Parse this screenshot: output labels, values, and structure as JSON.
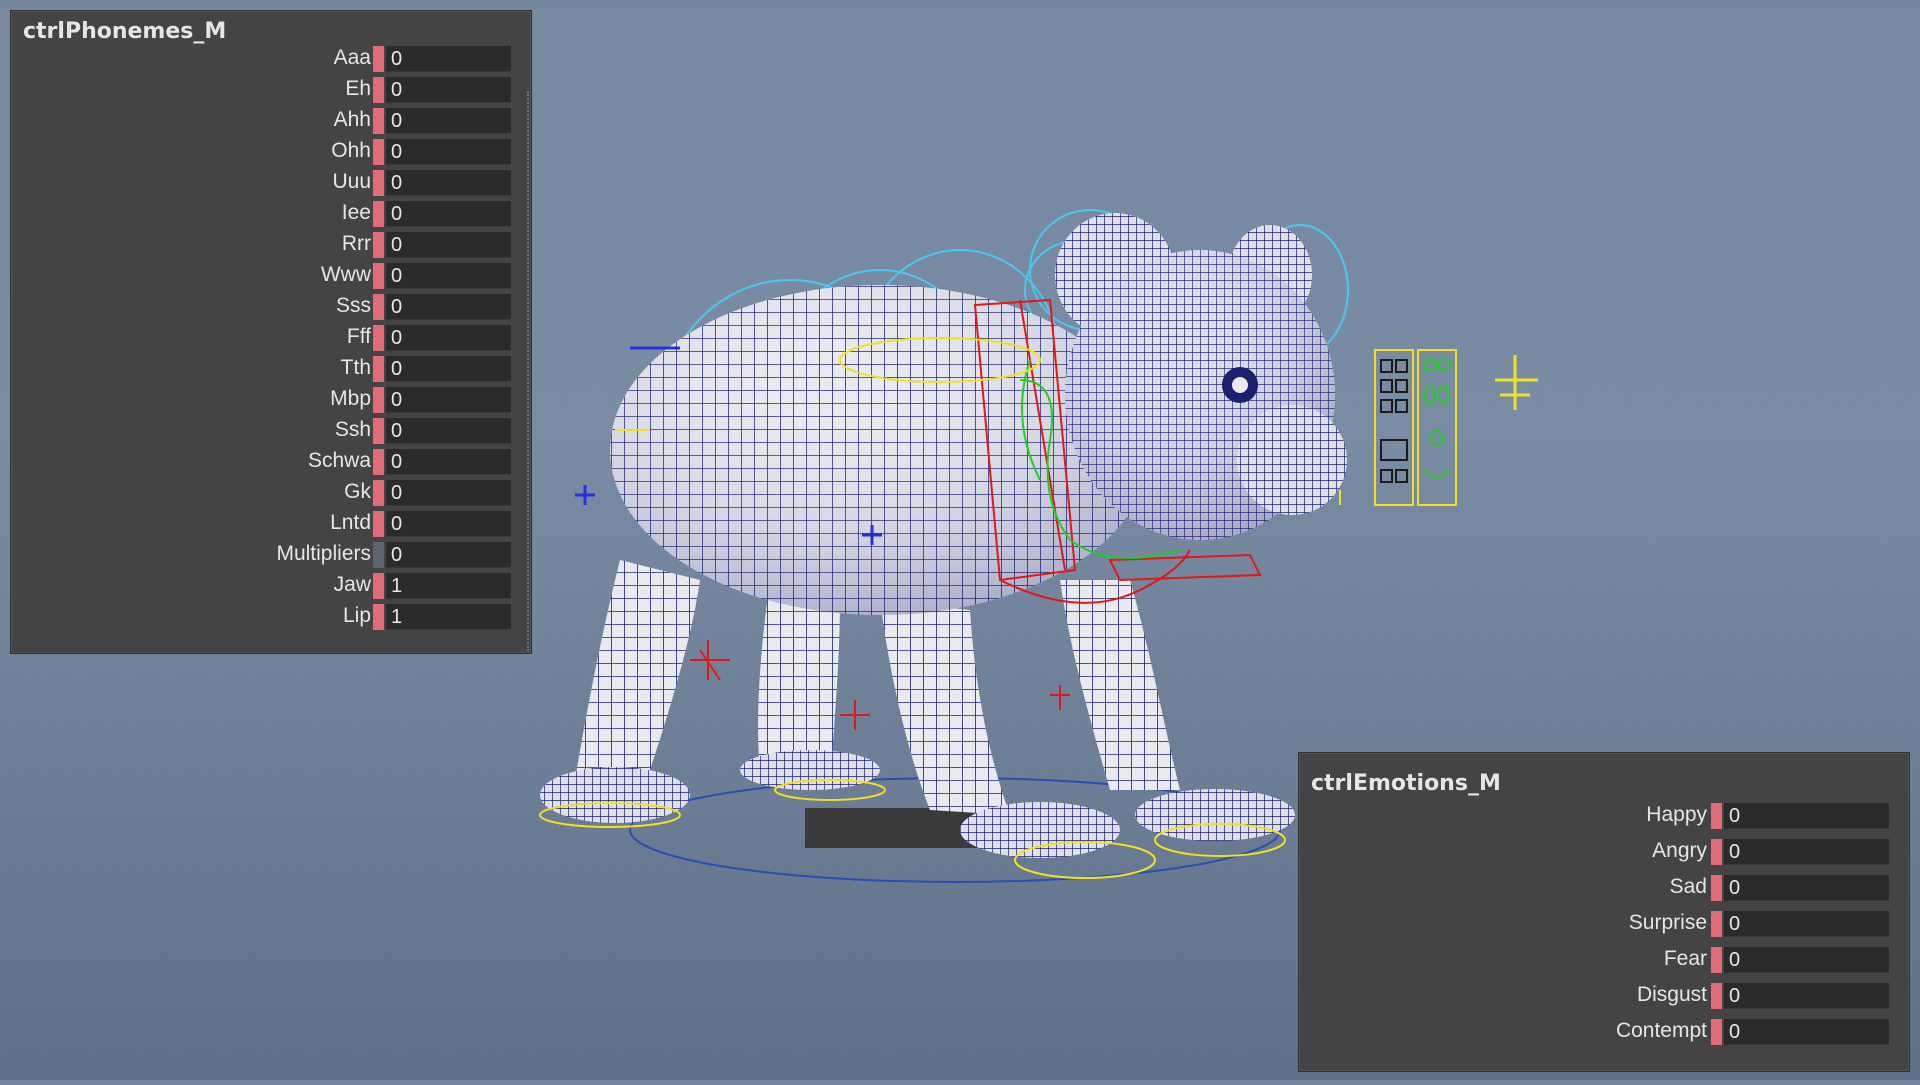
{
  "phonemes_panel": {
    "title": "ctrlPhonemes_M",
    "attributes": [
      {
        "label": "Aaa",
        "value": "0"
      },
      {
        "label": "Eh",
        "value": "0"
      },
      {
        "label": "Ahh",
        "value": "0"
      },
      {
        "label": "Ohh",
        "value": "0"
      },
      {
        "label": "Uuu",
        "value": "0"
      },
      {
        "label": "Iee",
        "value": "0"
      },
      {
        "label": "Rrr",
        "value": "0"
      },
      {
        "label": "Www",
        "value": "0"
      },
      {
        "label": "Sss",
        "value": "0"
      },
      {
        "label": "Fff",
        "value": "0"
      },
      {
        "label": "Tth",
        "value": "0"
      },
      {
        "label": "Mbp",
        "value": "0"
      },
      {
        "label": "Ssh",
        "value": "0"
      },
      {
        "label": "Schwa",
        "value": "0"
      },
      {
        "label": "Gk",
        "value": "0"
      },
      {
        "label": "Lntd",
        "value": "0"
      },
      {
        "label": "Multipliers",
        "value": "0"
      },
      {
        "label": "Jaw",
        "value": "1"
      },
      {
        "label": "Lip",
        "value": "1"
      }
    ]
  },
  "emotions_panel": {
    "title": "ctrlEmotions_M",
    "attributes": [
      {
        "label": "Happy",
        "value": "0"
      },
      {
        "label": "Angry",
        "value": "0"
      },
      {
        "label": "Sad",
        "value": "0"
      },
      {
        "label": "Surprise",
        "value": "0"
      },
      {
        "label": "Fear",
        "value": "0"
      },
      {
        "label": "Disgust",
        "value": "0"
      },
      {
        "label": "Contempt",
        "value": "0"
      }
    ]
  },
  "colors": {
    "keyed": "#e36b77",
    "mesh_wire": "#1a1f6e",
    "rig_cyan": "#48c8f0",
    "rig_red": "#e01818",
    "rig_yellow": "#f0e020",
    "rig_green": "#22cc22"
  },
  "viewport_icons": [
    "koala-mesh-icon",
    "facial-control-board-icon",
    "locator-icon"
  ]
}
